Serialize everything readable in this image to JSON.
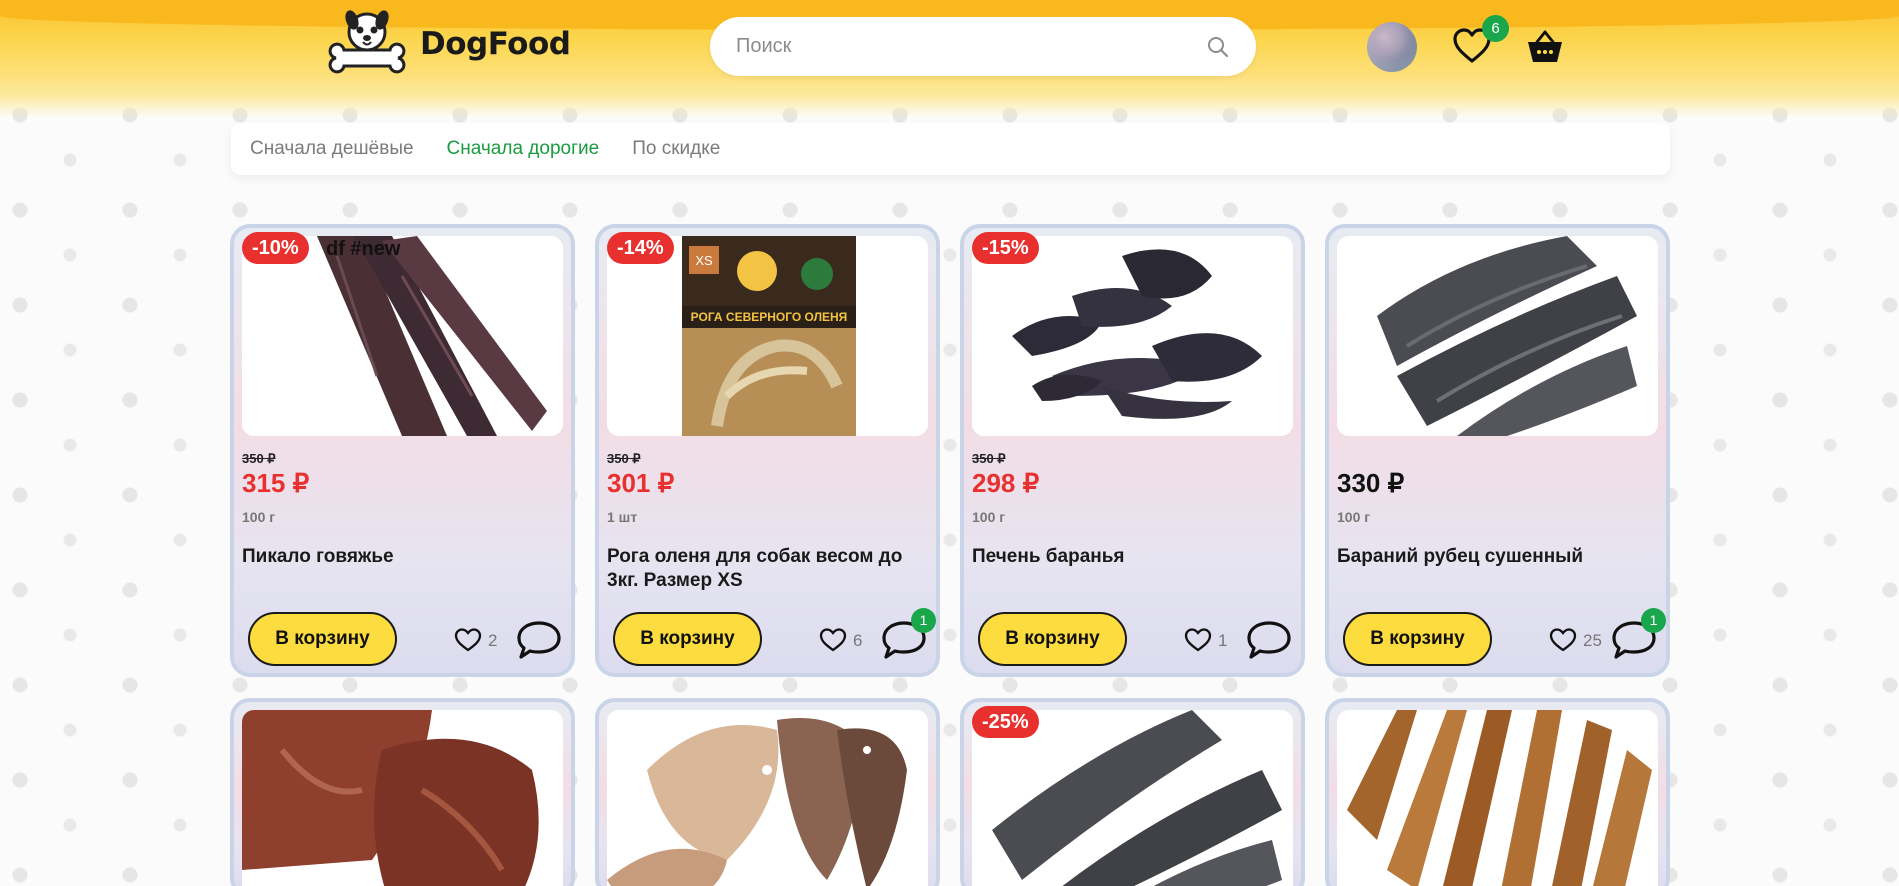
{
  "header": {
    "logo_text": "DogFood",
    "search_placeholder": "Поиск",
    "favorites_count": "6"
  },
  "sort": {
    "options": [
      "Сначала дешёвые",
      "Сначала дорогие",
      "По скидке"
    ],
    "active": "Сначала дорогие"
  },
  "products": [
    {
      "discount": "-10%",
      "tags": "df  #new",
      "old_price": "350 ₽",
      "price": "315 ₽",
      "weight": "100 г",
      "name": "Пикало говяжье",
      "button": "В корзину",
      "likes": "2",
      "comments": ""
    },
    {
      "discount": "-14%",
      "tags": "",
      "old_price": "350 ₽",
      "price": "301 ₽",
      "weight": "1 шт",
      "name": "Рога оленя для собак весом до 3кг. Размер XS",
      "button": "В корзину",
      "likes": "6",
      "comments": "1",
      "package_label": "РОГА СЕВЕРНОГО ОЛЕНЯ",
      "package_size": "XS"
    },
    {
      "discount": "-15%",
      "tags": "",
      "old_price": "350 ₽",
      "price": "298 ₽",
      "weight": "100 г",
      "name": "Печень баранья",
      "button": "В корзину",
      "likes": "1",
      "comments": ""
    },
    {
      "discount": "",
      "tags": "",
      "old_price": "",
      "price": "330 ₽",
      "weight": "100 г",
      "name": "Бараний рубец сушенный",
      "button": "В корзину",
      "likes": "25",
      "comments": "1"
    },
    {
      "discount": ""
    },
    {
      "discount": ""
    },
    {
      "discount": "-25%"
    },
    {
      "discount": ""
    }
  ],
  "colors": {
    "accent": "#fddc3f",
    "discount": "#e8302f",
    "active_sort": "#1a9c40",
    "badge": "#1aa64b"
  }
}
